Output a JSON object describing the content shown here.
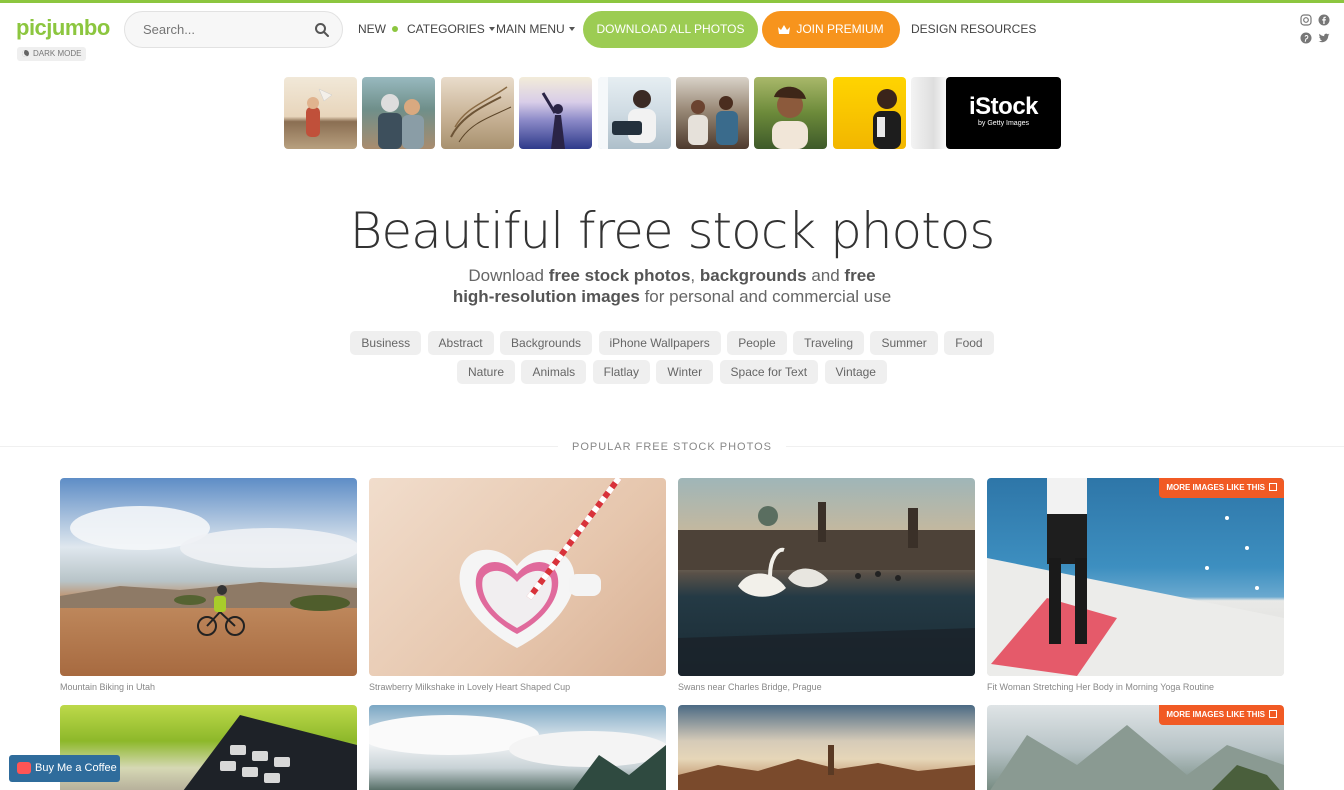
{
  "header": {
    "logo": "picjumbo",
    "dark_mode": "DARK MODE",
    "search_placeholder": "Search...",
    "nav_new": "NEW",
    "nav_categories": "CATEGORIES",
    "nav_main_menu": "MAIN MENU",
    "download_all": "DOWNLOAD ALL PHOTOS",
    "join_premium": "JOIN PREMIUM",
    "design_resources": "DESIGN RESOURCES",
    "social_icons": [
      "instagram-icon",
      "facebook-icon",
      "pinterest-icon",
      "twitter-icon"
    ]
  },
  "stock_strip": {
    "brand": "iStock",
    "brand_sub": "by Getty Images"
  },
  "hero": {
    "title": "Beautiful free stock photos",
    "sub_1": "Download ",
    "sub_2": "free stock photos",
    "sub_3": ", ",
    "sub_4": "backgrounds",
    "sub_5": " and ",
    "sub_6": "free high-resolution images",
    "sub_7": " for personal and commercial use"
  },
  "tags_row1": [
    "Business",
    "Abstract",
    "Backgrounds",
    "iPhone Wallpapers",
    "People",
    "Traveling",
    "Summer",
    "Food"
  ],
  "tags_row2": [
    "Nature",
    "Animals",
    "Flatlay",
    "Winter",
    "Space for Text",
    "Vintage"
  ],
  "popular": {
    "title": "POPULAR FREE STOCK PHOTOS",
    "more_label": "MORE IMAGES LIKE THIS",
    "photos": [
      {
        "caption": "Mountain Biking in Utah"
      },
      {
        "caption": "Strawberry Milkshake in Lovely Heart Shaped Cup"
      },
      {
        "caption": "Swans near Charles Bridge, Prague"
      },
      {
        "caption": "Fit Woman Stretching Her Body in Morning Yoga Routine"
      }
    ]
  },
  "coffee": {
    "label": "Buy Me a Coffee"
  },
  "colors": {
    "brand_green": "#8cc63f",
    "premium_orange": "#f7941d",
    "badge_orange": "#f15a24"
  }
}
